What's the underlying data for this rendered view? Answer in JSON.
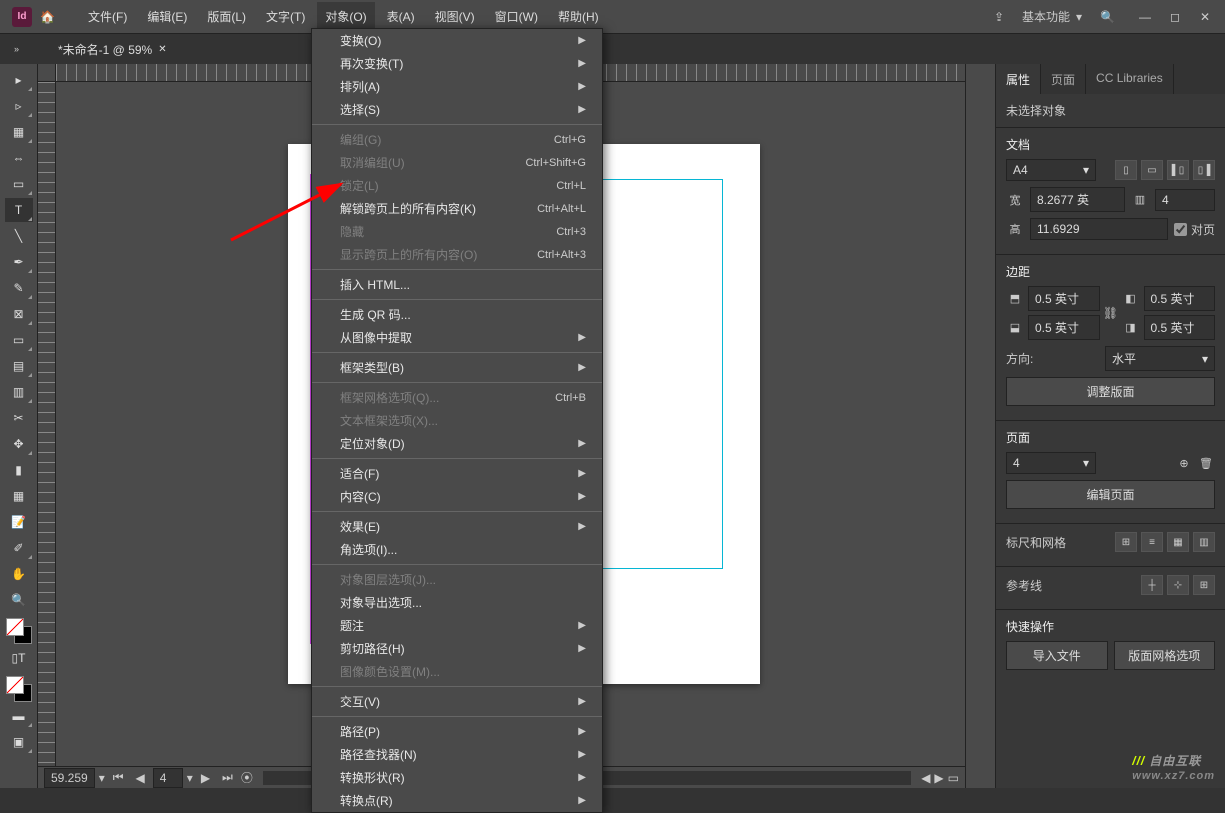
{
  "menubar": {
    "items": [
      "文件(F)",
      "编辑(E)",
      "版面(L)",
      "文字(T)",
      "对象(O)",
      "表(A)",
      "视图(V)",
      "窗口(W)",
      "帮助(H)"
    ],
    "workspace": "基本功能",
    "app_initials": "Id"
  },
  "tabs": {
    "doc_title": "*未命名-1 @ 59%"
  },
  "dropdown": {
    "rows": [
      {
        "label": "变换(O)",
        "sub": true
      },
      {
        "label": "再次变换(T)",
        "sub": true
      },
      {
        "label": "排列(A)",
        "sub": true
      },
      {
        "label": "选择(S)",
        "sub": true
      },
      {
        "sep": true
      },
      {
        "label": "编组(G)",
        "short": "Ctrl+G",
        "disabled": true
      },
      {
        "label": "取消编组(U)",
        "short": "Ctrl+Shift+G",
        "disabled": true
      },
      {
        "label": "锁定(L)",
        "short": "Ctrl+L",
        "disabled": true
      },
      {
        "label": "解锁跨页上的所有内容(K)",
        "short": "Ctrl+Alt+L"
      },
      {
        "label": "隐藏",
        "short": "Ctrl+3",
        "disabled": true
      },
      {
        "label": "显示跨页上的所有内容(O)",
        "short": "Ctrl+Alt+3",
        "disabled": true
      },
      {
        "sep": true
      },
      {
        "label": "插入 HTML..."
      },
      {
        "sep": true
      },
      {
        "label": "生成 QR 码..."
      },
      {
        "label": "从图像中提取",
        "sub": true
      },
      {
        "sep": true
      },
      {
        "label": "框架类型(B)",
        "sub": true
      },
      {
        "sep": true
      },
      {
        "label": "框架网格选项(Q)...",
        "short": "Ctrl+B",
        "disabled": true
      },
      {
        "label": "文本框架选项(X)...",
        "disabled": true
      },
      {
        "label": "定位对象(D)",
        "sub": true
      },
      {
        "sep": true
      },
      {
        "label": "适合(F)",
        "sub": true
      },
      {
        "label": "内容(C)",
        "sub": true
      },
      {
        "sep": true
      },
      {
        "label": "效果(E)",
        "sub": true
      },
      {
        "label": "角选项(I)..."
      },
      {
        "sep": true
      },
      {
        "label": "对象图层选项(J)...",
        "disabled": true
      },
      {
        "label": "对象导出选项..."
      },
      {
        "label": "题注",
        "sub": true
      },
      {
        "label": "剪切路径(H)",
        "sub": true
      },
      {
        "label": "图像颜色设置(M)...",
        "disabled": true
      },
      {
        "sep": true
      },
      {
        "label": "交互(V)",
        "sub": true
      },
      {
        "sep": true
      },
      {
        "label": "路径(P)",
        "sub": true
      },
      {
        "label": "路径查找器(N)",
        "sub": true
      },
      {
        "label": "转换形状(R)",
        "sub": true
      },
      {
        "label": "转换点(R)",
        "sub": true
      }
    ]
  },
  "status": {
    "zoom": "59.259",
    "page": "4"
  },
  "panel": {
    "tabs": [
      "属性",
      "页面",
      "CC Libraries"
    ],
    "no_sel": "未选择对象",
    "doc_label": "文档",
    "preset": "A4",
    "w_label": "宽",
    "w_val": "8.2677 英",
    "h_label": "高",
    "h_val": "11.6929",
    "pages_val": "4",
    "facing": "对页",
    "margin_label": "边距",
    "m_top": "0.5 英寸",
    "m_bottom": "0.5 英寸",
    "m_left": "0.5 英寸",
    "m_right": "0.5 英寸",
    "orient_label": "方向:",
    "orient_val": "水平",
    "adjust": "调整版面",
    "page_section": "页面",
    "page_sel": "4",
    "edit_page": "编辑页面",
    "ruler_grid": "标尺和网格",
    "guides": "参考线",
    "quick": "快速操作",
    "import_file": "导入文件",
    "grid_opts": "版面网格选项"
  },
  "watermark": {
    "text": "自由互联",
    "domain": "www.xz7.com"
  }
}
